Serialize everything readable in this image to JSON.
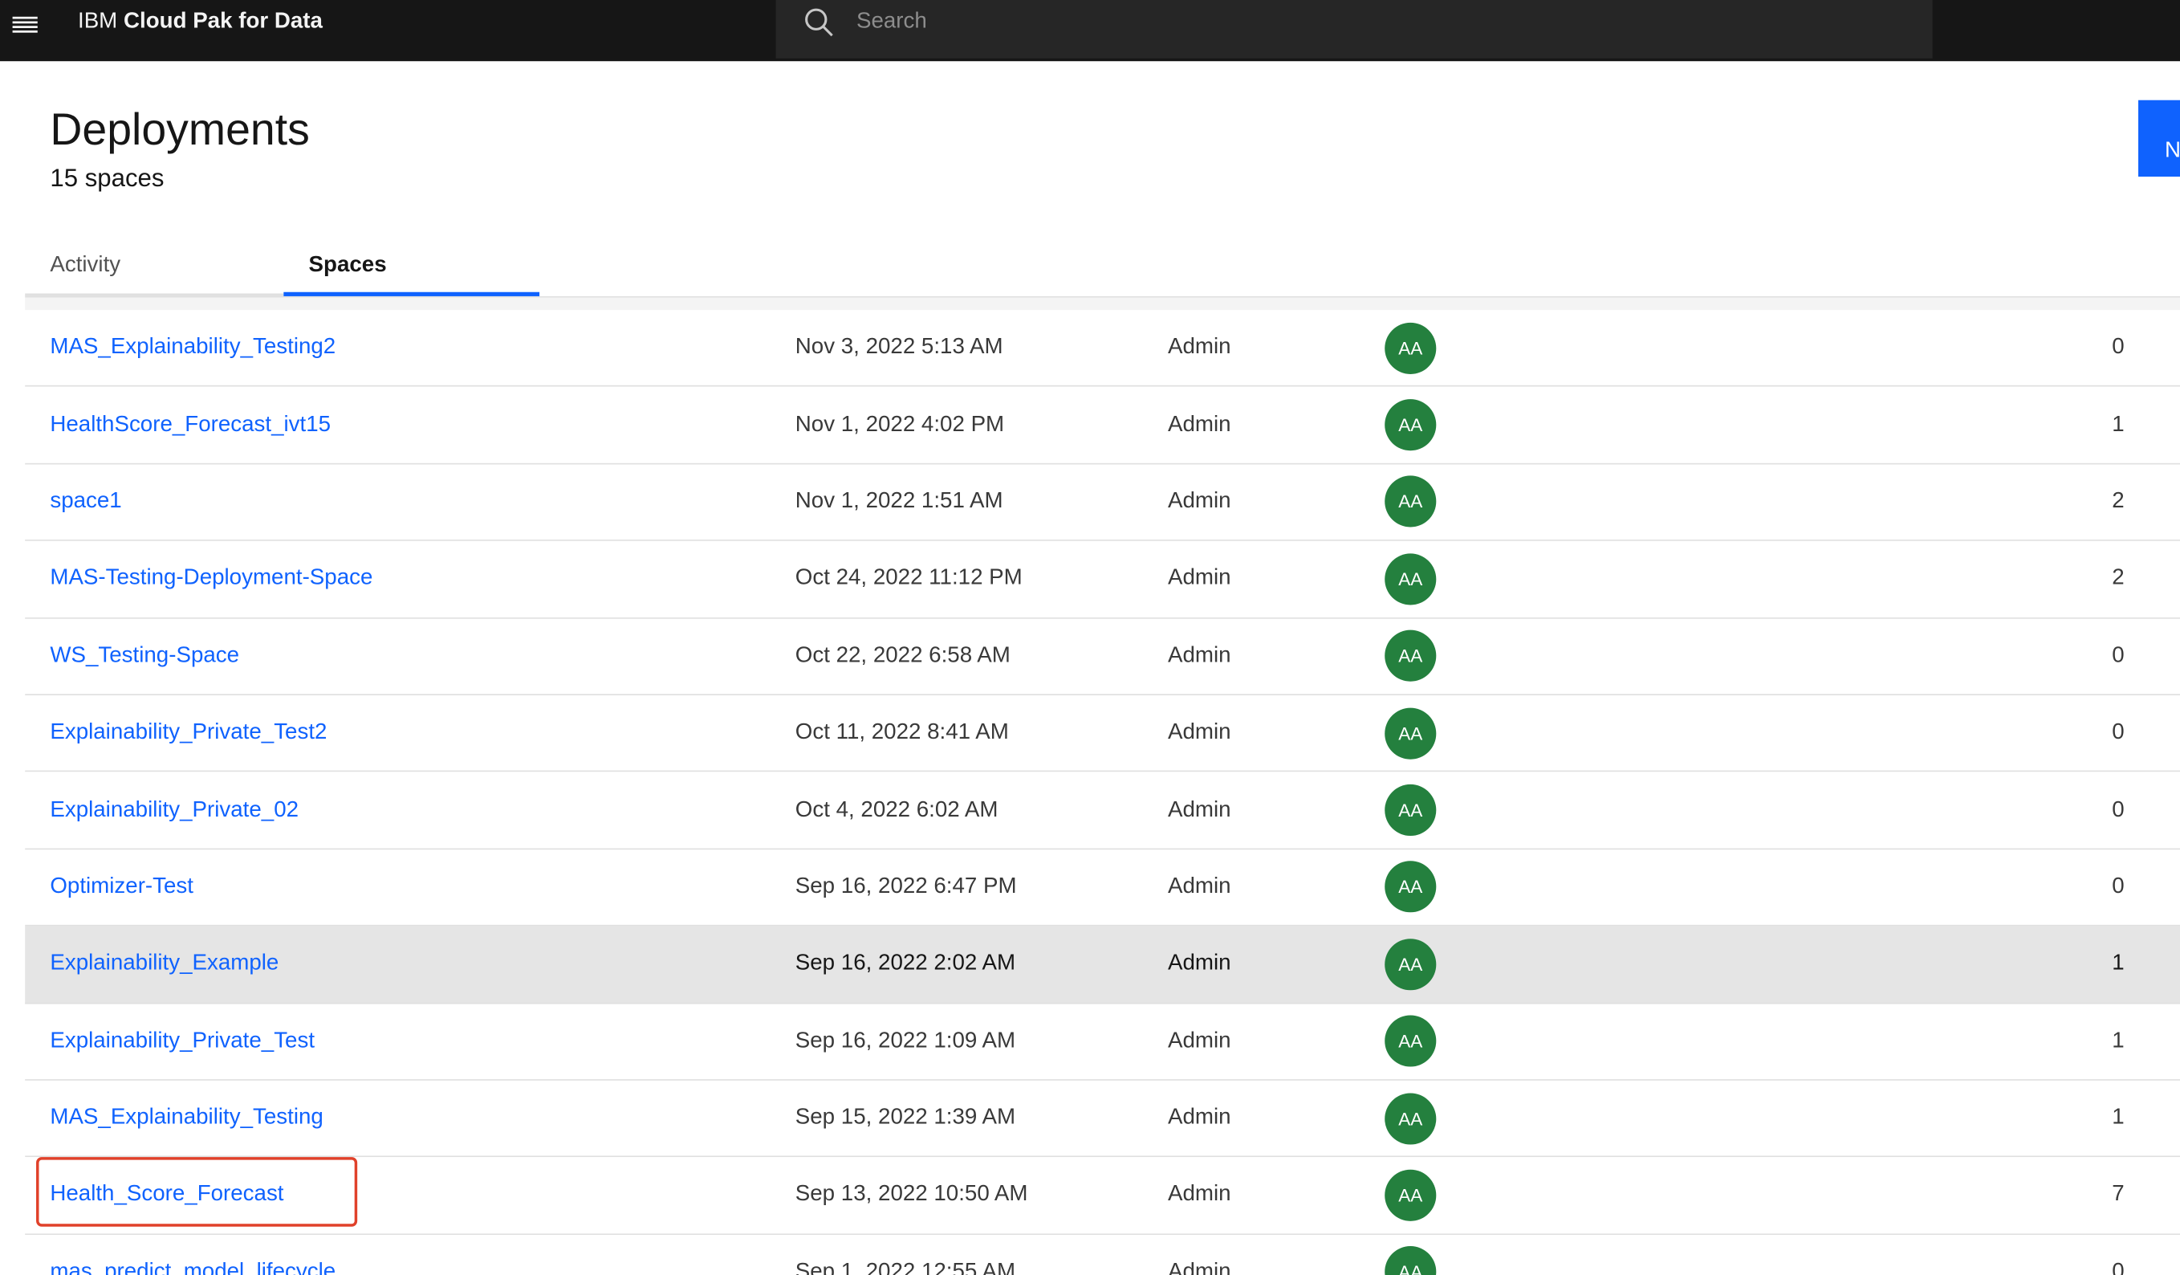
{
  "header": {
    "menu_icon": "hamburger-menu-icon",
    "brand_prefix": "IBM",
    "brand_name": "Cloud Pak for Data",
    "search_icon": "search-icon",
    "search_placeholder": "Search",
    "background_color": "#161616"
  },
  "page": {
    "title": "Deployments",
    "subtitle": "15 spaces",
    "new_button_label": "N"
  },
  "tabs": [
    {
      "label": "Activity",
      "selected": false
    },
    {
      "label": "Spaces",
      "selected": true
    }
  ],
  "colors": {
    "link": "#0f62fe",
    "avatar": "#24803e",
    "highlight_row": "#e5e5e5",
    "annotation": "#e0412a",
    "primary_button": "#0f62fe"
  },
  "spaces": [
    {
      "name": "MAS_Explainability_Testing2",
      "date": "Nov 3, 2022 5:13 AM",
      "role": "Admin",
      "avatar": "AA",
      "count": "0"
    },
    {
      "name": "HealthScore_Forecast_ivt15",
      "date": "Nov 1, 2022 4:02 PM",
      "role": "Admin",
      "avatar": "AA",
      "count": "1"
    },
    {
      "name": "space1",
      "date": "Nov 1, 2022 1:51 AM",
      "role": "Admin",
      "avatar": "AA",
      "count": "2"
    },
    {
      "name": "MAS-Testing-Deployment-Space",
      "date": "Oct 24, 2022 11:12 PM",
      "role": "Admin",
      "avatar": "AA",
      "count": "2"
    },
    {
      "name": "WS_Testing-Space",
      "date": "Oct 22, 2022 6:58 AM",
      "role": "Admin",
      "avatar": "AA",
      "count": "0"
    },
    {
      "name": "Explainability_Private_Test2",
      "date": "Oct 11, 2022 8:41 AM",
      "role": "Admin",
      "avatar": "AA",
      "count": "0"
    },
    {
      "name": "Explainability_Private_02",
      "date": "Oct 4, 2022 6:02 AM",
      "role": "Admin",
      "avatar": "AA",
      "count": "0"
    },
    {
      "name": "Optimizer-Test",
      "date": "Sep 16, 2022 6:47 PM",
      "role": "Admin",
      "avatar": "AA",
      "count": "0"
    },
    {
      "name": "Explainability_Example",
      "date": "Sep 16, 2022 2:02 AM",
      "role": "Admin",
      "avatar": "AA",
      "count": "1",
      "hovered": true
    },
    {
      "name": "Explainability_Private_Test",
      "date": "Sep 16, 2022 1:09 AM",
      "role": "Admin",
      "avatar": "AA",
      "count": "1"
    },
    {
      "name": "MAS_Explainability_Testing",
      "date": "Sep 15, 2022 1:39 AM",
      "role": "Admin",
      "avatar": "AA",
      "count": "1"
    },
    {
      "name": "Health_Score_Forecast",
      "date": "Sep 13, 2022 10:50 AM",
      "role": "Admin",
      "avatar": "AA",
      "count": "7",
      "annotated": true
    },
    {
      "name": "mas_predict_model_lifecycle",
      "date": "Sep 1, 2022 12:55 AM",
      "role": "Admin",
      "avatar": "AA",
      "count": "0"
    }
  ]
}
